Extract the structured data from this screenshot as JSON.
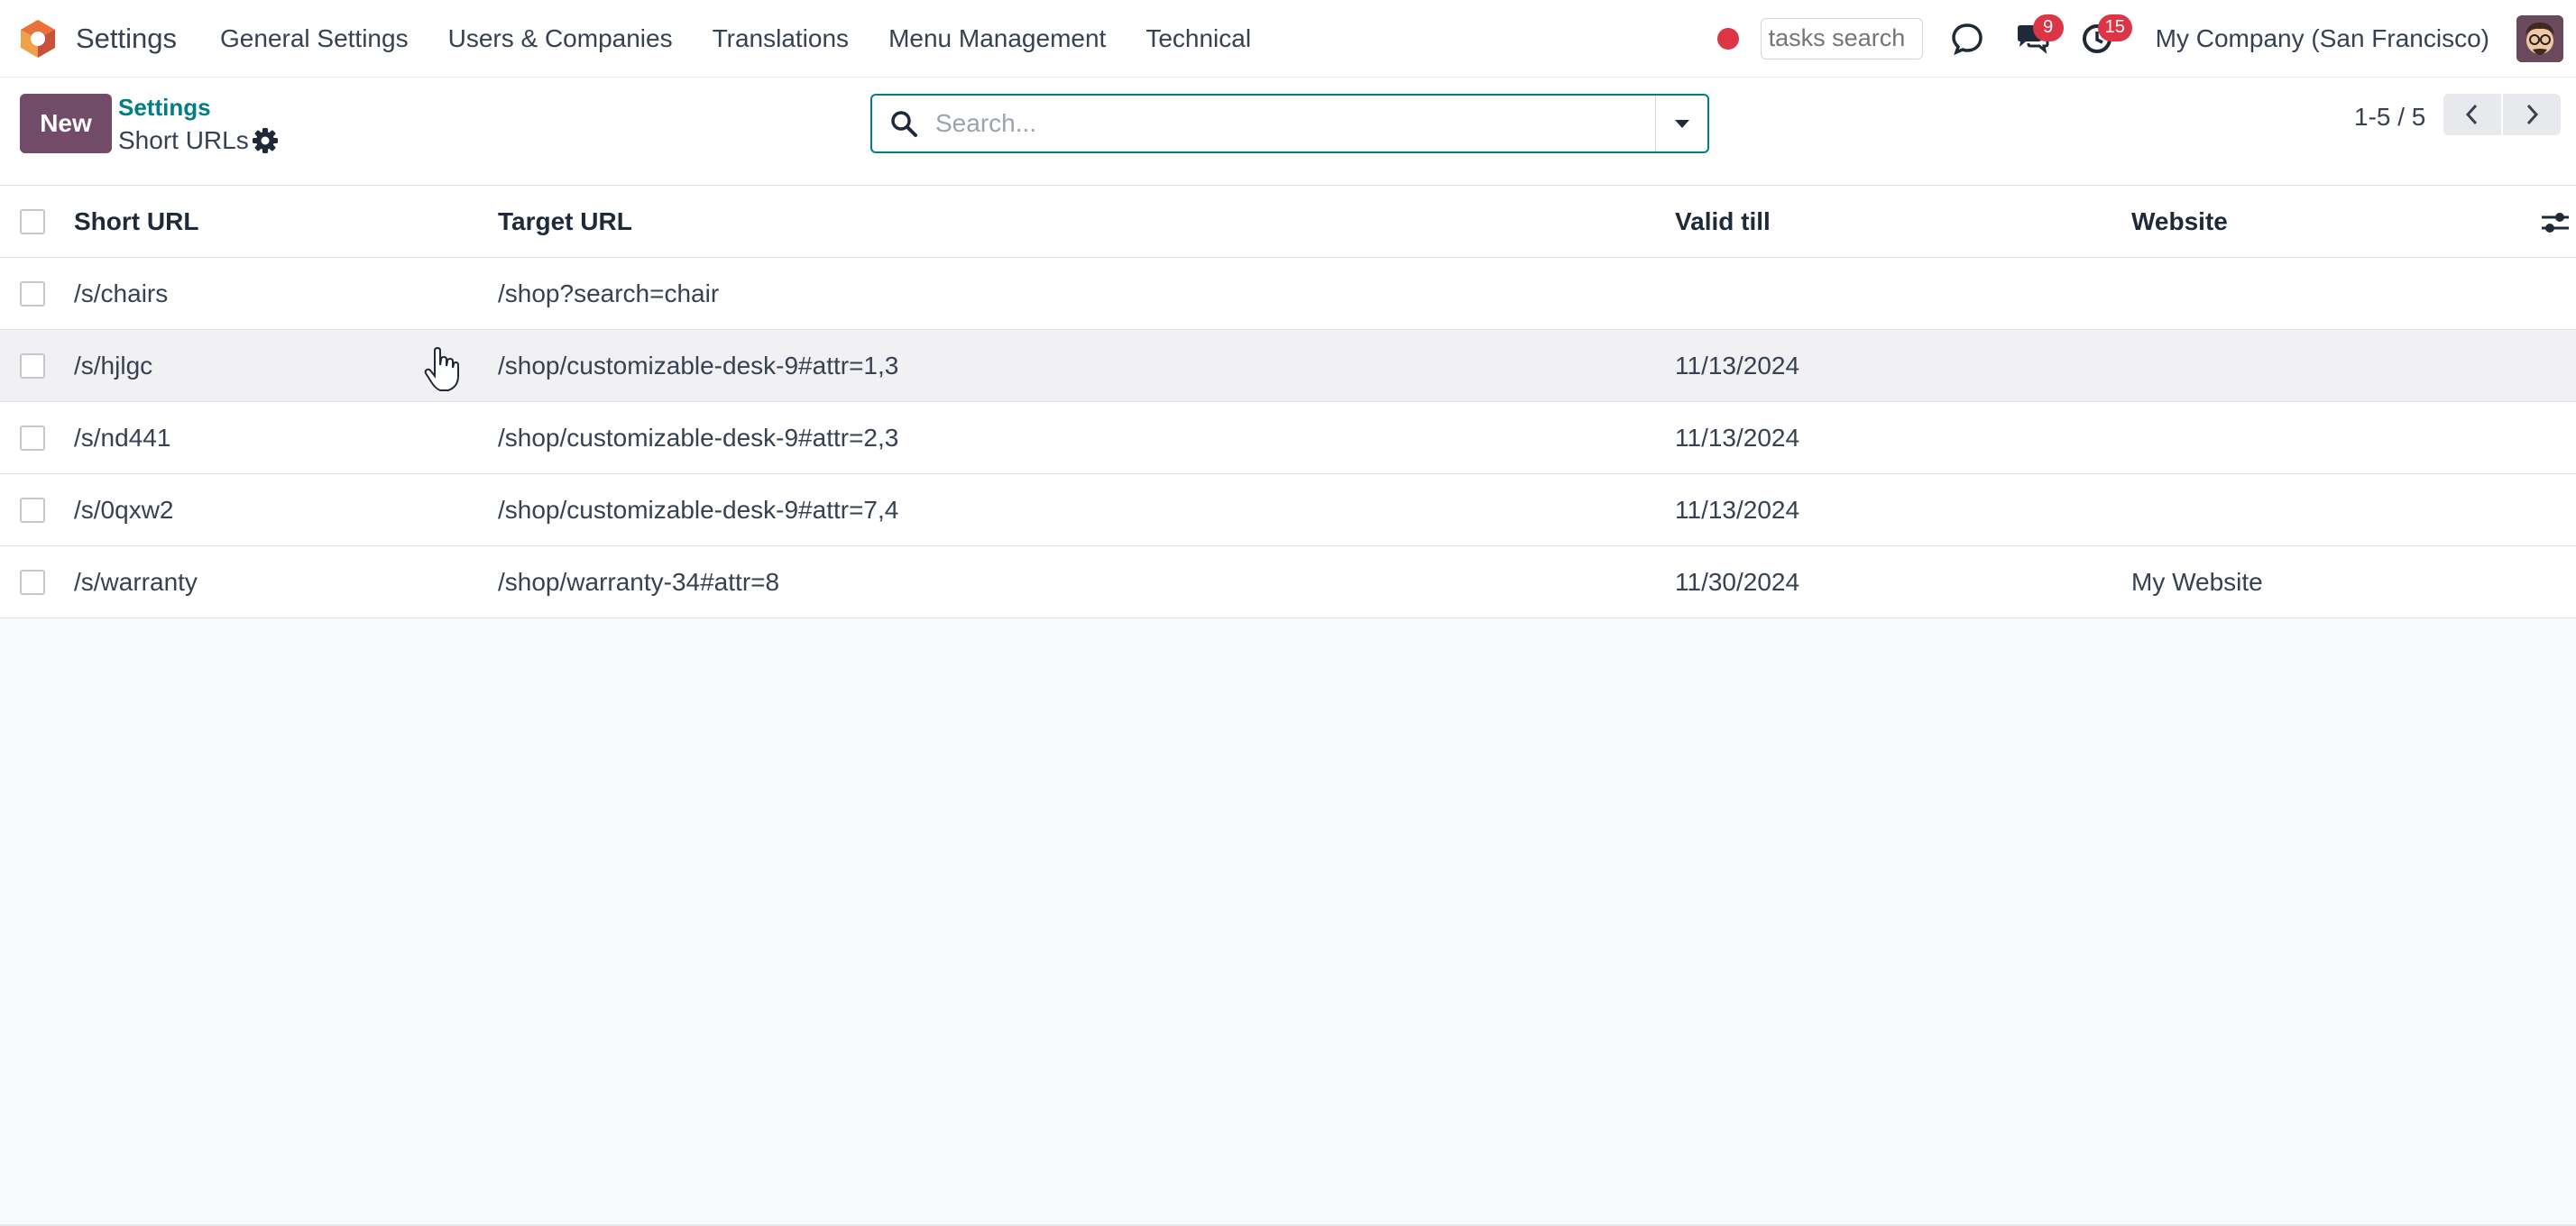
{
  "navbar": {
    "app_name": "Settings",
    "menu": [
      "General Settings",
      "Users & Companies",
      "Translations",
      "Menu Management",
      "Technical"
    ],
    "tasks_search_placeholder": "tasks search",
    "messages_badge": "9",
    "activities_badge": "15",
    "company": "My Company (San Francisco)"
  },
  "control_panel": {
    "new_label": "New",
    "breadcrumb_parent": "Settings",
    "breadcrumb_current": "Short URLs",
    "search_placeholder": "Search...",
    "pager": "1-5 / 5"
  },
  "table": {
    "columns": [
      "Short URL",
      "Target URL",
      "Valid till",
      "Website"
    ],
    "rows": [
      {
        "short": "/s/chairs",
        "target": "/shop?search=chair",
        "valid": "",
        "website": ""
      },
      {
        "short": "/s/hjlgc",
        "target": "/shop/customizable-desk-9#attr=1,3",
        "valid": "11/13/2024",
        "website": ""
      },
      {
        "short": "/s/nd441",
        "target": "/shop/customizable-desk-9#attr=2,3",
        "valid": "11/13/2024",
        "website": ""
      },
      {
        "short": "/s/0qxw2",
        "target": "/shop/customizable-desk-9#attr=7,4",
        "valid": "11/13/2024",
        "website": ""
      },
      {
        "short": "/s/warranty",
        "target": "/shop/warranty-34#attr=8",
        "valid": "11/30/2024",
        "website": "My Website"
      }
    ]
  },
  "colors": {
    "brand": "#714b67",
    "link": "#017e84",
    "badge": "#dc3545"
  },
  "icons": [
    "odoo-logo-icon",
    "record-dot-icon",
    "chat-icon",
    "messages-icon",
    "activity-clock-icon",
    "gear-icon",
    "search-icon",
    "caret-down-icon",
    "chevron-left-icon",
    "chevron-right-icon",
    "optional-columns-icon",
    "hand-cursor-icon"
  ]
}
